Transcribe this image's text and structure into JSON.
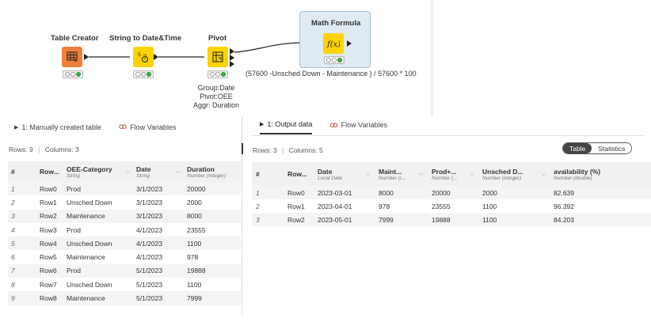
{
  "workflow": {
    "nodes": [
      {
        "name": "Table Creator",
        "icon": "table-grid-icon",
        "color": "#f0813a"
      },
      {
        "name": "String to Date&Time",
        "icon": "string-to-date-icon",
        "color": "#fdd400"
      },
      {
        "name": "Pivot",
        "icon": "pivot-icon",
        "color": "#fdd400"
      },
      {
        "name": "Math Formula",
        "icon": "math-formula-icon",
        "color": "#fdd400"
      }
    ],
    "pivot_annotation": [
      "Group:Date",
      "Pivot:OEE",
      "Aggr: Duration"
    ],
    "math_annotation": "(57600 -Unsched Down - Maintenance ) / 57600 * 100"
  },
  "left_panel": {
    "tabs": [
      "1: Manually created table",
      "Flow Variables"
    ],
    "rows_label": "Rows: 9",
    "columns_label": "Columns: 3",
    "headers": [
      {
        "name": "#",
        "type": ""
      },
      {
        "name": "Row...",
        "type": ""
      },
      {
        "name": "OEE-Category",
        "type": "String"
      },
      {
        "name": "Date",
        "type": "String"
      },
      {
        "name": "Duration",
        "type": "Number (integer)"
      }
    ],
    "rows": [
      [
        "1",
        "Row0",
        "Prod",
        "3/1/2023",
        "20000"
      ],
      [
        "2",
        "Row1",
        "Unsched Down",
        "3/1/2023",
        "2000"
      ],
      [
        "3",
        "Row2",
        "Maintenance",
        "3/1/2023",
        "8000"
      ],
      [
        "4",
        "Row3",
        "Prod",
        "4/1/2023",
        "23555"
      ],
      [
        "5",
        "Row4",
        "Unsched Down",
        "4/1/2023",
        "1100"
      ],
      [
        "6",
        "Row5",
        "Maintenance",
        "4/1/2023",
        "978"
      ],
      [
        "7",
        "Row6",
        "Prod",
        "5/1/2023",
        "19888"
      ],
      [
        "8",
        "Row7",
        "Unsched Down",
        "5/1/2023",
        "1100"
      ],
      [
        "9",
        "Row8",
        "Maintenance",
        "5/1/2023",
        "7999"
      ]
    ]
  },
  "right_panel": {
    "tabs": [
      "1: Output data",
      "Flow Variables"
    ],
    "rows_label": "Rows: 3",
    "columns_label": "Columns: 5",
    "toggle": [
      "Table",
      "Statistics"
    ],
    "headers": [
      {
        "name": "#",
        "type": ""
      },
      {
        "name": "Row...",
        "type": ""
      },
      {
        "name": "Date",
        "type": "Local Date"
      },
      {
        "name": "Maint...",
        "type": "Number (i..."
      },
      {
        "name": "Prod+...",
        "type": "Number (..."
      },
      {
        "name": "Unsched D...",
        "type": "Number (integer)"
      },
      {
        "name": "availability (%)",
        "type": "Number (double)"
      }
    ],
    "rows": [
      [
        "1",
        "Row0",
        "2023-03-01",
        "8000",
        "20000",
        "2000",
        "82.639"
      ],
      [
        "2",
        "Row1",
        "2023-04-01",
        "978",
        "23555",
        "1100",
        "96.392"
      ],
      [
        "3",
        "Row2",
        "2023-05-01",
        "7999",
        "19888",
        "1100",
        "84.203"
      ]
    ]
  }
}
